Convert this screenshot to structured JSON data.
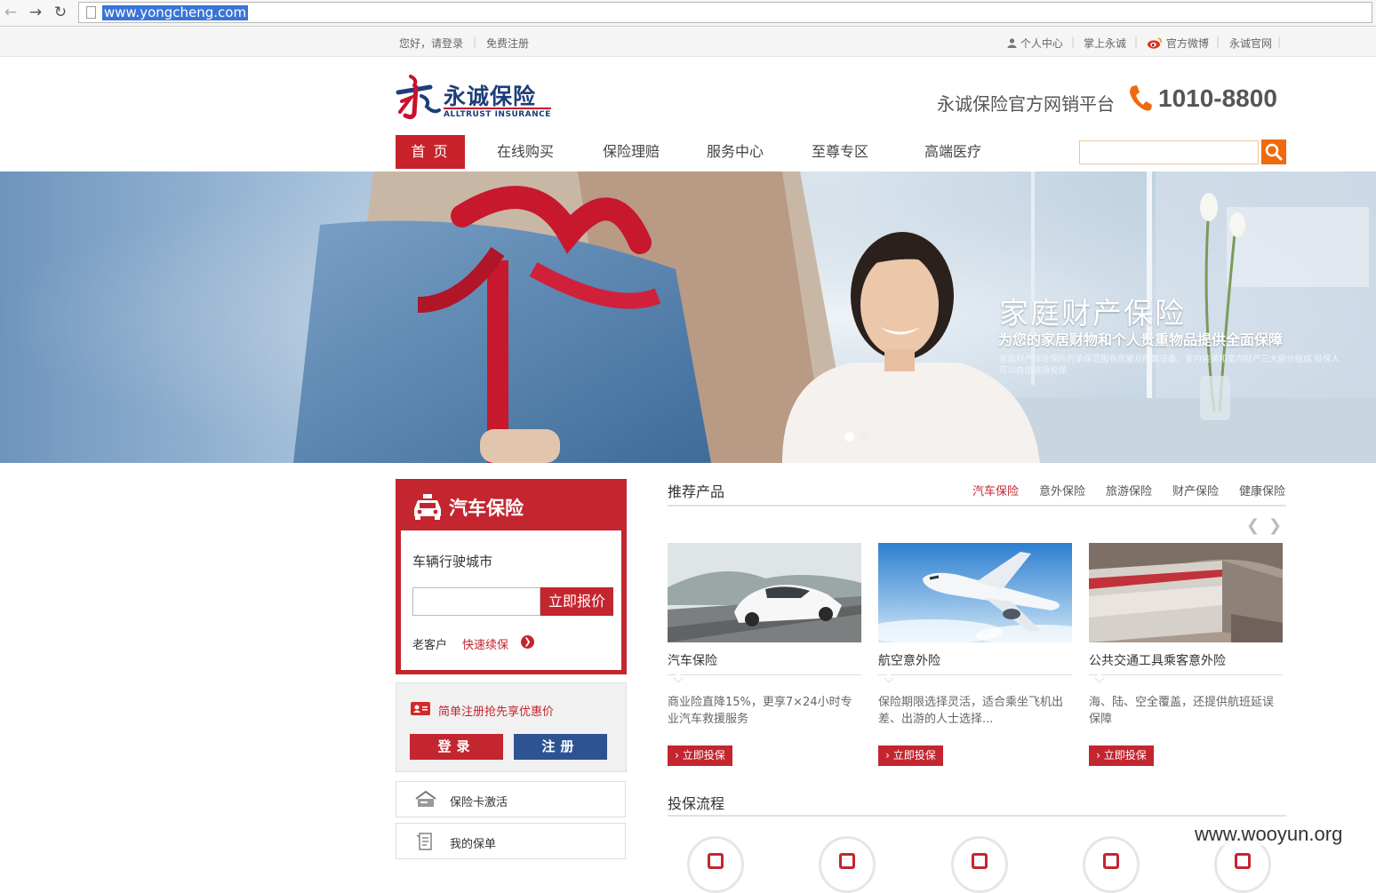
{
  "browser": {
    "url": "www.yongcheng.com"
  },
  "topbar": {
    "greeting": "您好，请登录",
    "register": "免费注册",
    "personal_center": "个人中心",
    "mobile": "掌上永诚",
    "weibo": "官方微博",
    "official_site": "永诚官网"
  },
  "header": {
    "logo_cn": "永诚保险",
    "logo_en": "ALLTRUST INSURANCE",
    "platform": "永诚保险官方网销平台",
    "phone": "1010-8800"
  },
  "nav": {
    "items": [
      "首 页",
      "在线购买",
      "保险理赔",
      "服务中心",
      "至尊专区",
      "高端医疗"
    ]
  },
  "search": {
    "placeholder": ""
  },
  "banner": {
    "title": "家庭财产保险",
    "subtitle": "为您的家居财物和个人贵重物品提供全面保障",
    "desc": "家庭财产综合保险的承保范围有房屋及附属设备、室内装潢和室内财产三大部分组成 投保人可以自由选项投保",
    "slides": 2,
    "active_slide": 1
  },
  "car_panel": {
    "title": "汽车保险",
    "city_label": "车辆行驶城市",
    "city_value": "",
    "quote_button": "立即报价",
    "old_customer": "老客户",
    "renew_link": "快速续保"
  },
  "register_panel": {
    "promo": "简单注册抢先享优惠价",
    "login_button": "登录",
    "register_button": "注册"
  },
  "side_links": [
    {
      "label": "保险卡激活",
      "icon": "card-activate-icon"
    },
    {
      "label": "我的保单",
      "icon": "policy-icon"
    }
  ],
  "recommended": {
    "title": "推荐产品",
    "tabs": [
      "汽车保险",
      "意外保险",
      "旅游保险",
      "财产保险",
      "健康保险"
    ],
    "active_tab": 0,
    "products": [
      {
        "name": "汽车保险",
        "desc": "商业险直降15%，更享7×24小时专业汽车救援服务",
        "button": "立即投保"
      },
      {
        "name": "航空意外险",
        "desc": "保险期限选择灵活，适合乘坐飞机出差、出游的人士选择...",
        "button": "立即投保"
      },
      {
        "name": "公共交通工具乘客意外险",
        "desc": "海、陆、空全覆盖，还提供航班延误保障",
        "button": "立即投保"
      }
    ]
  },
  "flow": {
    "title": "投保流程"
  },
  "watermark": "www.wooyun.org",
  "colors": {
    "brand_red": "#c3262f",
    "brand_blue": "#2e5393",
    "search_orange": "#ef6a0c"
  }
}
